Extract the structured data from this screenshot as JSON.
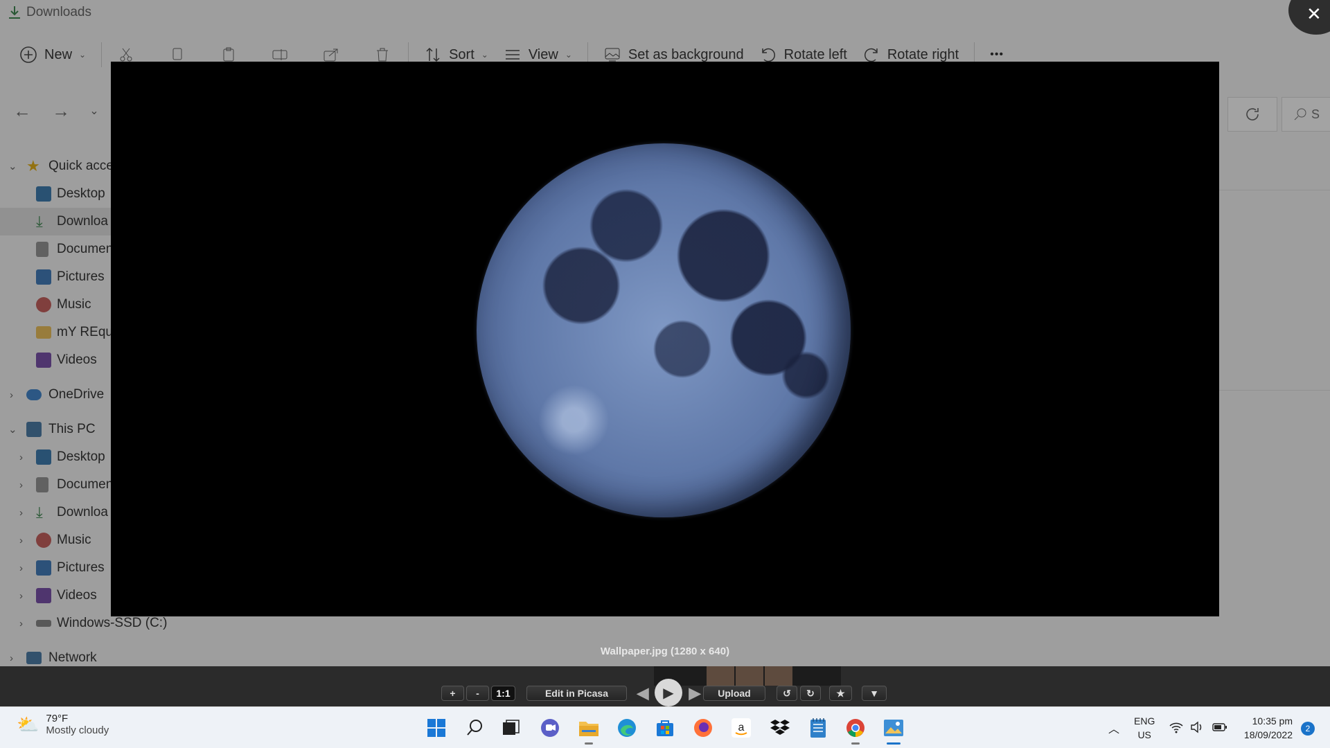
{
  "explorer": {
    "title": "Downloads",
    "toolbar": {
      "new_label": "New",
      "sort_label": "Sort",
      "view_label": "View",
      "set_background_label": "Set as background",
      "rotate_left_label": "Rotate left",
      "rotate_right_label": "Rotate right",
      "more_label": "•••"
    },
    "search_placeholder": "S",
    "sidebar": {
      "quick_access": "Quick acce",
      "items": [
        {
          "label": "Desktop",
          "icon": "desktop-icon"
        },
        {
          "label": "Downloa",
          "icon": "download-icon"
        },
        {
          "label": "Documen",
          "icon": "document-icon"
        },
        {
          "label": "Pictures",
          "icon": "pictures-icon"
        },
        {
          "label": "Music",
          "icon": "music-icon"
        },
        {
          "label": "mY REqui",
          "icon": "folder-icon"
        },
        {
          "label": "Videos",
          "icon": "videos-icon"
        }
      ],
      "onedrive": "OneDrive",
      "this_pc": "This PC",
      "pc_items": [
        {
          "label": "Desktop",
          "icon": "desktop-icon"
        },
        {
          "label": "Documen",
          "icon": "document-icon"
        },
        {
          "label": "Downloa",
          "icon": "download-icon"
        },
        {
          "label": "Music",
          "icon": "music-icon"
        },
        {
          "label": "Pictures",
          "icon": "pictures-icon"
        },
        {
          "label": "Videos",
          "icon": "videos-icon"
        },
        {
          "label": "Windows-SSD (C:)",
          "icon": "drive-icon"
        }
      ],
      "network": "Network"
    }
  },
  "viewer": {
    "caption": "Wallpaper.jpg (1280 x 640)",
    "close_label": "✕",
    "controls": {
      "zoom_in": "+",
      "zoom_out": "-",
      "actual_size": "1:1",
      "edit_label": "Edit in Picasa",
      "upload_label": "Upload",
      "rotate_ccw": "↺",
      "rotate_cw": "↻",
      "star": "★",
      "more": "▼"
    }
  },
  "taskbar": {
    "weather_temp": "79°F",
    "weather_desc": "Mostly cloudy",
    "lang_top": "ENG",
    "lang_bottom": "US",
    "time": "10:35 pm",
    "date": "18/09/2022",
    "notification_count": "2"
  },
  "colors": {
    "accent": "#1a73c9",
    "moon": "#6f88b8"
  }
}
